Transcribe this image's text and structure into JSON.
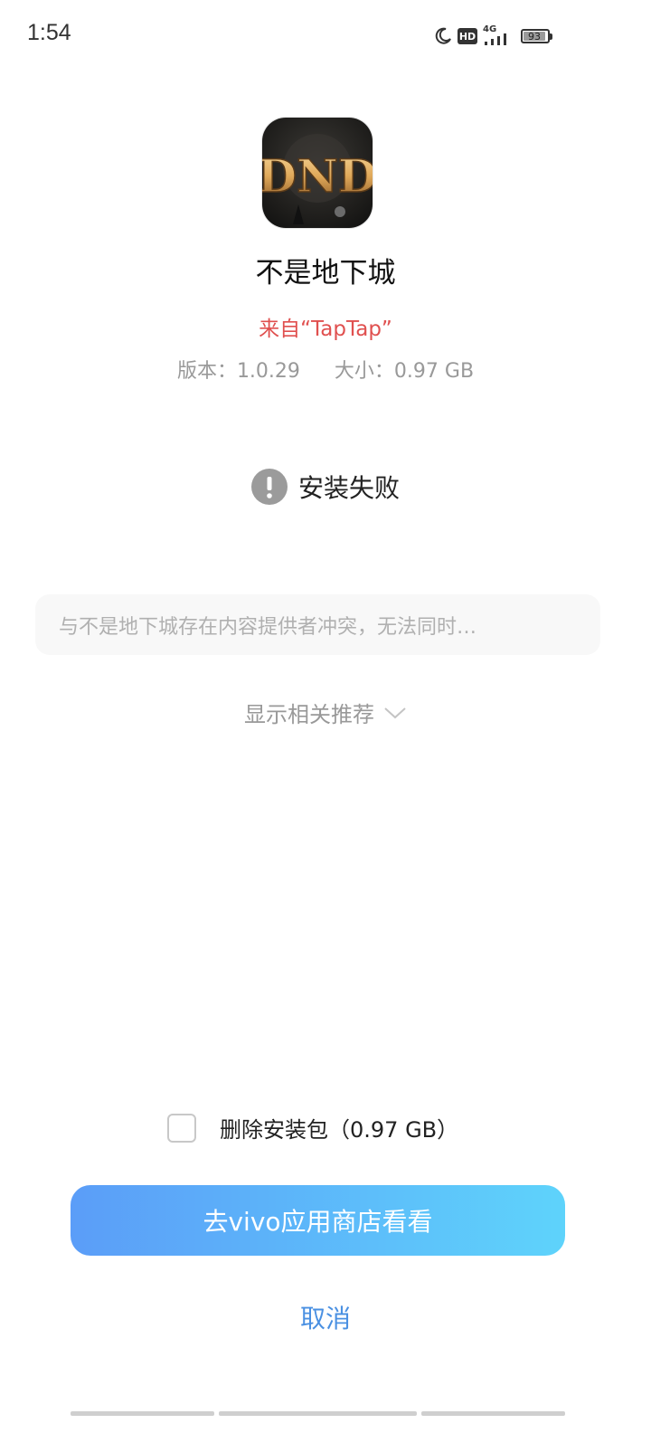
{
  "status_bar": {
    "time": "1:54",
    "network": "4G",
    "hd": "HD",
    "battery": "93"
  },
  "app": {
    "name": "不是地下城",
    "source": "来自“TapTap”",
    "version": "版本：1.0.29",
    "size": "大小：0.97 GB",
    "icon_letters": "DND"
  },
  "install": {
    "status": "安装失败",
    "message": "与不是地下城存在内容提供者冲突，无法同时…",
    "show_recommend": "显示相关推荐"
  },
  "actions": {
    "delete_package_label": "删除安装包（0.97 GB）",
    "delete_package_checked": false,
    "primary_button": "去vivo应用商店看看",
    "cancel": "取消"
  },
  "colors": {
    "source_red": "#e0504f",
    "accent_blue": "#4a90e2",
    "button_gradient_start": "#5b9df8",
    "button_gradient_end": "#5ed3fb"
  }
}
